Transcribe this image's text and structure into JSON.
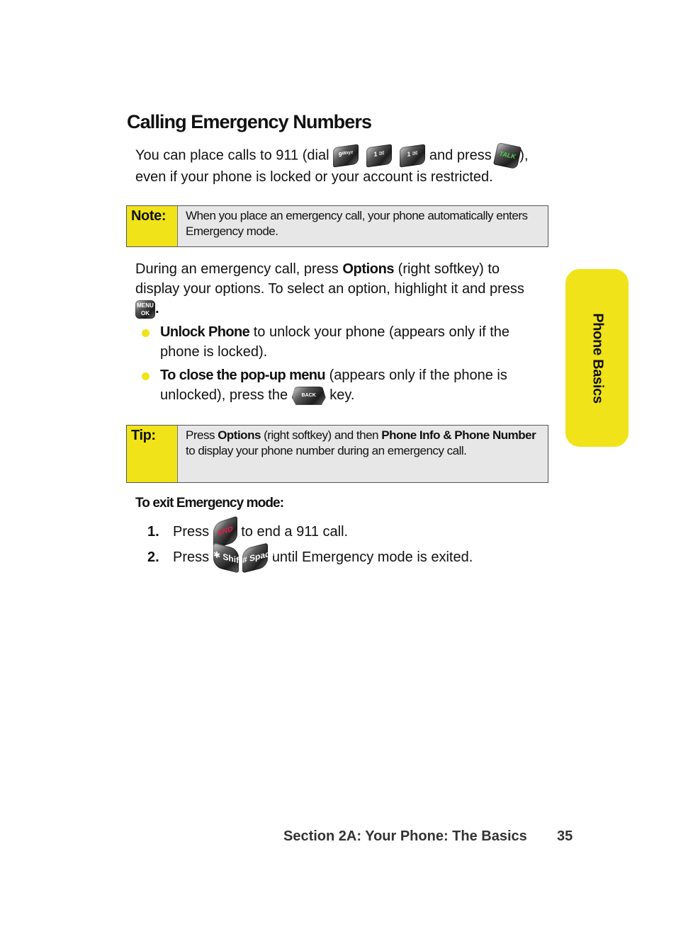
{
  "heading": "Calling Emergency Numbers",
  "intro": {
    "before_keys": "You can place calls to 911 (dial ",
    "keys": [
      {
        "name": "key-9",
        "label": "9ᵂˣʸᶻ"
      },
      {
        "name": "key-1",
        "label": "1 ✉"
      },
      {
        "name": "key-1",
        "label": "1 ✉"
      }
    ],
    "middle": " and press ",
    "talk_key": "TALK",
    "after": "),",
    "line2": "even if your phone is locked or your account is restricted."
  },
  "note": {
    "label": "Note:",
    "text": "When you place an emergency call, your phone automatically enters Emergency mode."
  },
  "options_para": {
    "t1": "During an emergency call, press ",
    "b1": "Options",
    "t2": " (right softkey) to display your options. To select an option, highlight it and press ",
    "menu_key_top": "MENU",
    "menu_key_bottom": "OK",
    "t3": "."
  },
  "bullets": [
    {
      "bold": "Unlock Phone",
      "text": " to unlock your phone (appears only if the phone is locked)."
    },
    {
      "bold": "To close the pop-up menu",
      "text": " (appears only if the phone is unlocked), press the ",
      "key": "BACK",
      "after": " key."
    }
  ],
  "tip": {
    "label": "Tip:",
    "t1": "Press ",
    "b1": "Options",
    "t2": " (right softkey) and then ",
    "b2": "Phone Info & Phone Number",
    "t3": " to display your phone number during an emergency call."
  },
  "exit_heading": "To exit Emergency mode:",
  "steps": [
    {
      "num": "1.",
      "before": "Press ",
      "keys": [
        "END"
      ],
      "after": " to end a 911 call."
    },
    {
      "num": "2.",
      "before": "Press ",
      "keys": [
        "✱ Shift",
        "# Space"
      ],
      "after": " until Emergency mode is exited."
    }
  ],
  "side_tab": "Phone Basics",
  "footer": {
    "section": "Section 2A: Your Phone: The Basics",
    "page": "35"
  },
  "colors": {
    "accent_yellow": "#f0e31a",
    "box_gray": "#e7e7e7"
  }
}
